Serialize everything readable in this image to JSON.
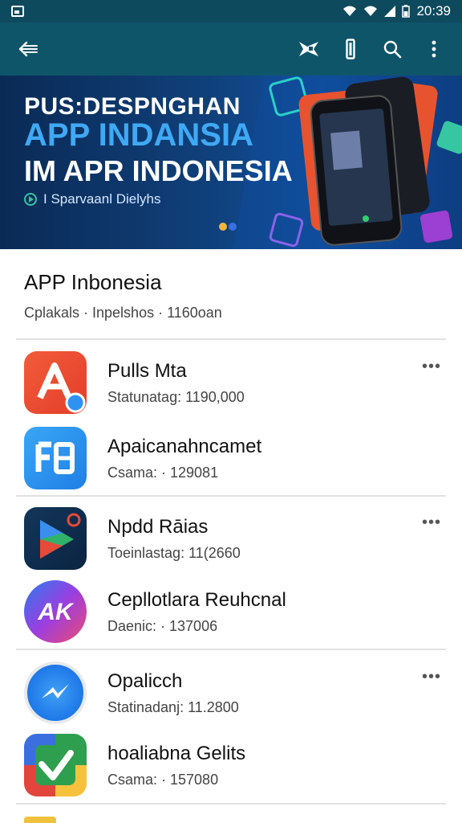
{
  "status_bar": {
    "time": "20:39"
  },
  "toolbar": {
    "icons": [
      "back-arrow-icon",
      "flag-icon",
      "bookmark-icon",
      "search-icon",
      "more-vertical-icon"
    ]
  },
  "banner": {
    "line1": "PUS:DESPNGHAN",
    "line2": "APP INDANSIA",
    "line3": "IM APR INDONESIA",
    "subtitle": "I Sparvaanl Dielyhs"
  },
  "section": {
    "title": "APP Inbonesia",
    "subtitle": "Cplakals · Inpelshos · 1160oan"
  },
  "apps": [
    {
      "name": "Pulls Mta",
      "meta": "Statunatag: 1190,000",
      "icon": "arrow-a-icon",
      "color": "#e84a2f",
      "has_more": true
    },
    {
      "name": "Apaicanahncamet",
      "meta": "Csama: · 129081",
      "icon": "grid-text-icon",
      "color": "#2a8ff0",
      "has_more": false
    },
    {
      "name": "Npdd Rāias",
      "meta": "Toeinlastag: 11(2660",
      "icon": "play-store-icon",
      "color": "#13365a",
      "has_more": true
    },
    {
      "name": "Cepllotlara Reuhcnal",
      "meta": "Daenic: · 137006",
      "icon": "ak-logo-icon",
      "color": "#7b48e6",
      "has_more": false
    },
    {
      "name": "Opalicch",
      "meta": "Statinadanj: 11.2800",
      "icon": "messenger-icon",
      "color": "#1e78e8",
      "has_more": true
    },
    {
      "name": "hoaliabna Gelits",
      "meta": "Csama: · 157080",
      "icon": "checkmark-icon",
      "color": "#2e9e4f",
      "has_more": false
    }
  ],
  "more_label": "•••"
}
